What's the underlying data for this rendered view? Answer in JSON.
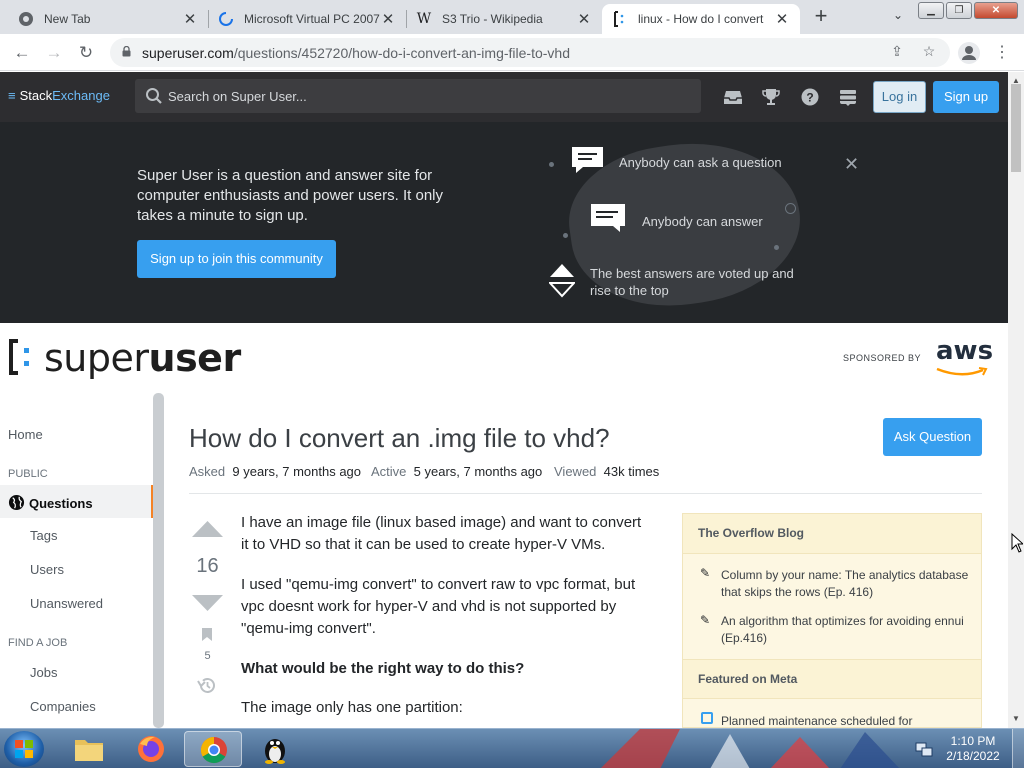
{
  "browser": {
    "tabs": [
      {
        "title": "New Tab"
      },
      {
        "title": "Microsoft Virtual PC 2007"
      },
      {
        "title": "S3 Trio - Wikipedia"
      },
      {
        "title": "linux - How do I convert"
      }
    ],
    "url_host": "superuser.com",
    "url_path": "/questions/452720/how-do-i-convert-an-img-file-to-vhd"
  },
  "se_bar": {
    "logo_stack": "Stack",
    "logo_exchange": "Exchange",
    "search_placeholder": "Search on Super User...",
    "login_label": "Log in",
    "signup_label": "Sign up"
  },
  "hero": {
    "text": "Super User is a question and answer site for computer enthusiasts and power users. It only takes a minute to sign up.",
    "cta": "Sign up to join this community",
    "features": [
      "Anybody can ask a question",
      "Anybody can answer",
      "The best answers are voted up and rise to the top"
    ]
  },
  "site": {
    "logo_light": "super",
    "logo_bold": "user",
    "sponsored_by": "SPONSORED BY",
    "sponsor": "aws"
  },
  "nav": {
    "home": "Home",
    "public_head": "PUBLIC",
    "questions": "Questions",
    "tags": "Tags",
    "users": "Users",
    "unanswered": "Unanswered",
    "job_head": "FIND A JOB",
    "jobs": "Jobs",
    "companies": "Companies"
  },
  "question": {
    "title": "How do I convert an .img file to vhd?",
    "ask_button": "Ask Question",
    "asked_label": "Asked",
    "asked_value": "9 years, 7 months ago",
    "active_label": "Active",
    "active_value": "5 years, 7 months ago",
    "viewed_label": "Viewed",
    "viewed_value": "43k times",
    "votes": "16",
    "bookmarks": "5",
    "body": [
      "I have an image file (linux based image) and want to convert it to VHD so that it can be used to create hyper-V VMs.",
      "I used \"qemu-img convert\" to convert raw to vpc format, but vpc doesnt work for hyper-V and vhd is not supported by \"qemu-img convert\".",
      "What would be the right way to do this?",
      "The image only has one partition:"
    ]
  },
  "sidebar": {
    "blog_head": "The Overflow Blog",
    "blog_items": [
      "Column by your name: The analytics database that skips the rows (Ep. 416)",
      "An algorithm that optimizes for avoiding ennui (Ep.416)"
    ],
    "meta_head": "Featured on Meta",
    "meta_items": [
      "Planned maintenance scheduled for"
    ]
  },
  "taskbar": {
    "time": "1:10 PM",
    "date": "2/18/2022"
  },
  "colors": {
    "accent_blue": "#379fef",
    "active_nav": "#f48225",
    "hero_bg": "#232629",
    "topbar_bg": "#2d2d30"
  }
}
